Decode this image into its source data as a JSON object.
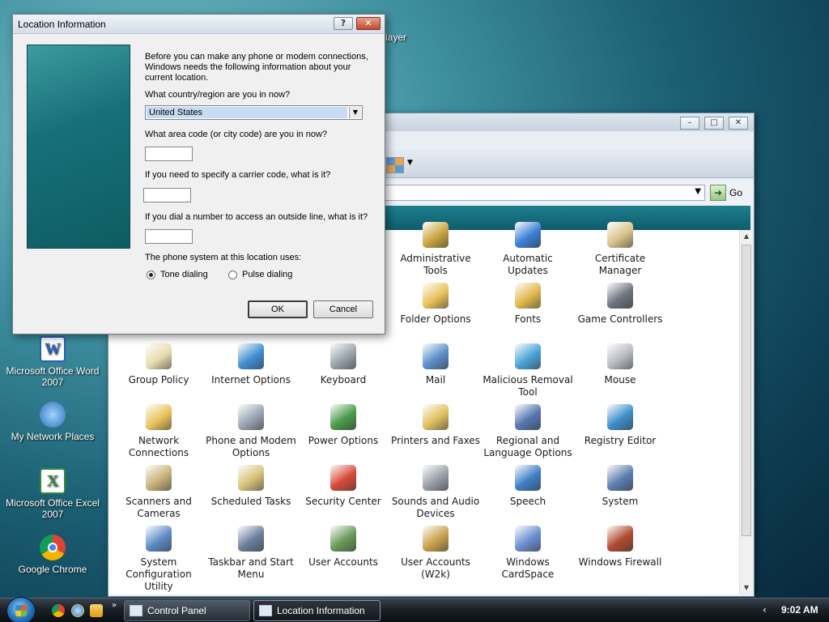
{
  "desktop": {
    "icons": [
      {
        "name": "word-icon",
        "label": "Microsoft Office Word 2007",
        "color": "#2b5fb4"
      },
      {
        "name": "network-icon",
        "label": "My Network Places",
        "color": "#3b78c6"
      },
      {
        "name": "excel-icon",
        "label": "Microsoft Office Excel 2007",
        "color": "#2f8a3f"
      },
      {
        "name": "chrome-icon",
        "label": "Google Chrome",
        "color": "#db4437"
      }
    ],
    "partial_label": "Player"
  },
  "control_panel": {
    "go_label": "Go",
    "items": [
      {
        "label": "Administrative Tools",
        "icon": "admin-tools-icon",
        "color": "#c9a640"
      },
      {
        "label": "Automatic Updates",
        "icon": "windows-update-icon",
        "color": "#3c7fd6"
      },
      {
        "label": "Certificate Manager",
        "icon": "certificate-icon",
        "color": "#d9c48a"
      },
      {
        "label": "Folder Options",
        "icon": "folder-options-icon",
        "color": "#e8c45c"
      },
      {
        "label": "Fonts",
        "icon": "fonts-icon",
        "color": "#e2b94e"
      },
      {
        "label": "Game Controllers",
        "icon": "gamepad-icon",
        "color": "#6d7580"
      },
      {
        "label": "Group Policy",
        "icon": "group-policy-icon",
        "color": "#e9dcb0"
      },
      {
        "label": "Internet Options",
        "icon": "internet-options-icon",
        "color": "#3f8fd3"
      },
      {
        "label": "Keyboard",
        "icon": "keyboard-icon",
        "color": "#9aa3ad"
      },
      {
        "label": "Mail",
        "icon": "mail-icon",
        "color": "#5b8fc9"
      },
      {
        "label": "Malicious Removal Tool",
        "icon": "removal-tool-icon",
        "color": "#49a3d7"
      },
      {
        "label": "Mouse",
        "icon": "mouse-icon",
        "color": "#b8bcc2"
      },
      {
        "label": "Network Connections",
        "icon": "network-connections-icon",
        "color": "#e8c45c"
      },
      {
        "label": "Phone and Modem Options",
        "icon": "phone-icon",
        "color": "#9aa6b4"
      },
      {
        "label": "Power Options",
        "icon": "power-icon",
        "color": "#4c9b4a"
      },
      {
        "label": "Printers and Faxes",
        "icon": "printer-icon",
        "color": "#e0c060"
      },
      {
        "label": "Regional and Language Options",
        "icon": "regional-icon",
        "color": "#5577b0"
      },
      {
        "label": "Registry Editor",
        "icon": "registry-icon",
        "color": "#3d8fc9"
      },
      {
        "label": "Scanners and Cameras",
        "icon": "scanner-icon",
        "color": "#c9b27a"
      },
      {
        "label": "Scheduled Tasks",
        "icon": "scheduled-tasks-icon",
        "color": "#d8c27a"
      },
      {
        "label": "Security Center",
        "icon": "security-shield-icon",
        "color": "#d94a3a"
      },
      {
        "label": "Sounds and Audio Devices",
        "icon": "speaker-icon",
        "color": "#9aa0a8"
      },
      {
        "label": "Speech",
        "icon": "speech-icon",
        "color": "#3f7fc7"
      },
      {
        "label": "System",
        "icon": "system-icon",
        "color": "#5b7fb0"
      },
      {
        "label": "System Configuration Utility",
        "icon": "msconfig-icon",
        "color": "#5d8bc4"
      },
      {
        "label": "Taskbar and Start Menu",
        "icon": "taskbar-icon",
        "color": "#6c7f9c"
      },
      {
        "label": "User Accounts",
        "icon": "user-accounts-icon",
        "color": "#6a9a5a"
      },
      {
        "label": "User Accounts (W2k)",
        "icon": "user-accounts-w2k-icon",
        "color": "#c9a24a"
      },
      {
        "label": "Windows CardSpace",
        "icon": "cardspace-icon",
        "color": "#6a8fd0"
      },
      {
        "label": "Windows Firewall",
        "icon": "firewall-icon",
        "color": "#b04a2f"
      }
    ]
  },
  "dialog": {
    "title": "Location Information",
    "help": "?",
    "close": "✕",
    "intro": "Before you can make any phone or modem connections, Windows needs the following information about your current location.",
    "country_q": "What country/region are you in now?",
    "country_value": "United States",
    "area_q": "What area code (or city code) are you in now?",
    "area_value": "",
    "carrier_q": "If you need to specify a carrier code, what is it?",
    "carrier_value": "",
    "outside_q": "If you dial a number to access an outside line, what is it?",
    "outside_value": "",
    "phone_system_q": "The phone system at this location uses:",
    "tone": "Tone dialing",
    "pulse": "Pulse dialing",
    "selected_dialing": "tone",
    "ok": "OK",
    "cancel": "Cancel"
  },
  "taskbar": {
    "more": "»",
    "buttons": [
      {
        "label": "Control Panel",
        "active": false
      },
      {
        "label": "Location Information",
        "active": true
      }
    ],
    "tray_arrow": "‹",
    "clock": "9:02 AM"
  }
}
